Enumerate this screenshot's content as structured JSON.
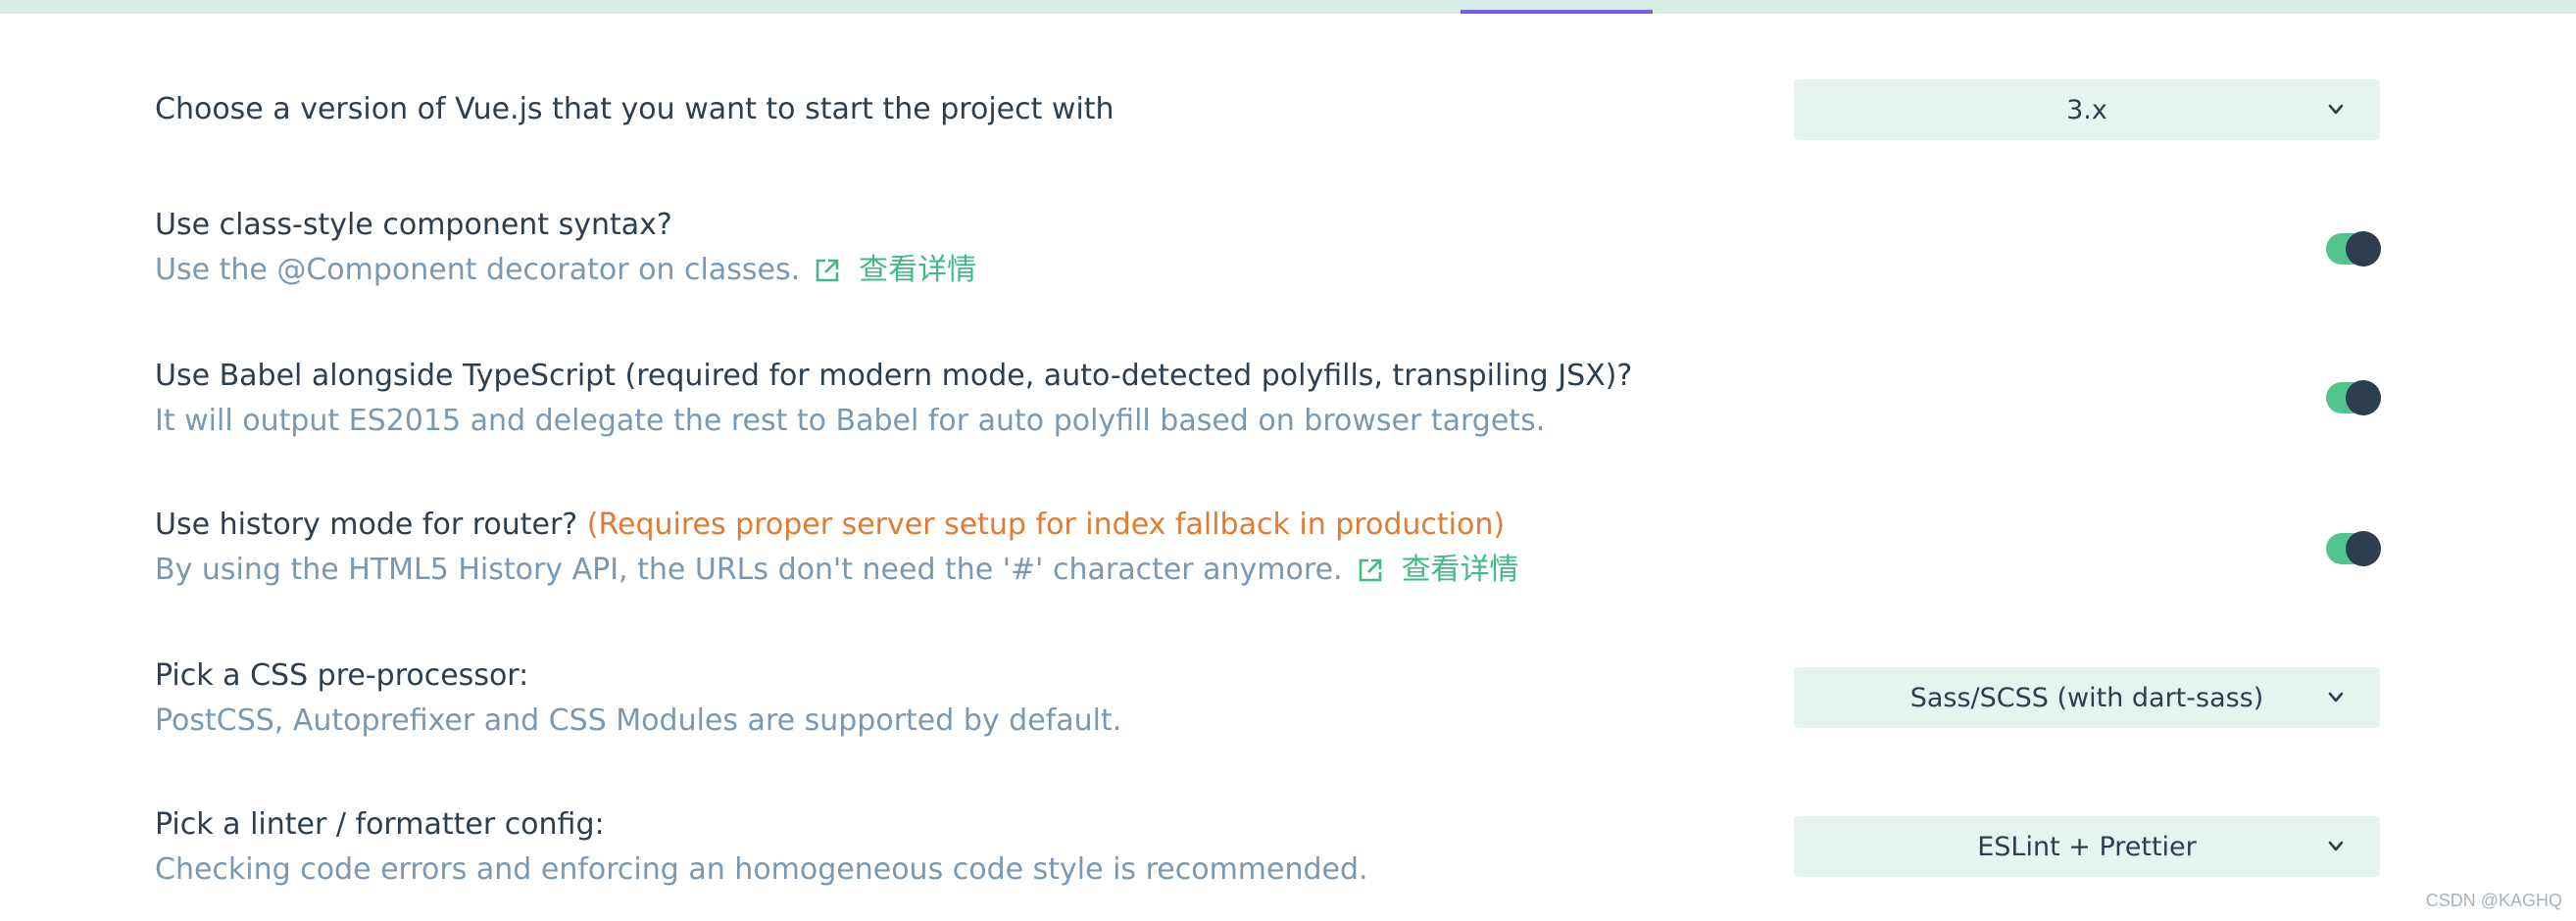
{
  "header": {
    "accent_color": "#7c5cdc",
    "bar_color": "#d7eee6"
  },
  "options": {
    "vue_version": {
      "title": "Choose a version of Vue.js that you want to start the project with",
      "selected": "3.x"
    },
    "class_component": {
      "title": "Use class-style component syntax?",
      "description": "Use the @Component decorator on classes.",
      "link_label": "查看详情",
      "enabled": true
    },
    "babel": {
      "title": "Use Babel alongside TypeScript (required for modern mode, auto-detected polyfills, transpiling JSX)?",
      "description": "It will output ES2015 and delegate the rest to Babel for auto polyfill based on browser targets.",
      "enabled": true
    },
    "history_mode": {
      "title": "Use history mode for router?",
      "warning": "(Requires proper server setup for index fallback in production)",
      "description": "By using the HTML5 History API, the URLs don't need the '#' character anymore.",
      "link_label": "查看详情",
      "enabled": true
    },
    "css_preprocessor": {
      "title": "Pick a CSS pre-processor:",
      "description": "PostCSS, Autoprefixer and CSS Modules are supported by default.",
      "selected": "Sass/SCSS (with dart-sass)"
    },
    "linter": {
      "title": "Pick a linter / formatter config:",
      "description": "Checking code errors and enforcing an homogeneous code style is recommended.",
      "selected": "ESLint + Prettier"
    }
  },
  "watermark": "CSDN @KAGHQ",
  "colors": {
    "text": "#2c3e50",
    "description": "#7a98b2",
    "link": "#42b983",
    "warning": "#e07b32",
    "toggle_on": "#52c48e",
    "select_bg": "#e6f3ee"
  },
  "icons": {
    "external_link": "external-link-icon",
    "dropdown": "chevron-down-icon"
  }
}
